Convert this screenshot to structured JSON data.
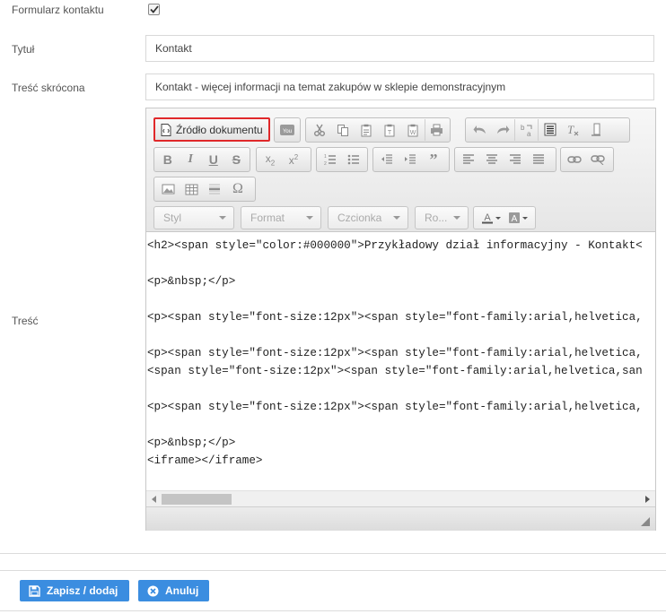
{
  "fields": {
    "contact_form_label": "Formularz kontaktu",
    "contact_form_checked": true,
    "title_label": "Tytuł",
    "title_value": "Kontakt",
    "summary_label": "Treść skrócona",
    "summary_value": "Kontakt - więcej informacji na temat zakupów w sklepie demonstracyjnym",
    "content_label": "Treść"
  },
  "editor": {
    "source_button_label": "Źródło dokumentu",
    "combos": {
      "style": "Styl",
      "format": "Format",
      "font": "Czcionka",
      "size": "Ro..."
    },
    "code_lines": [
      "<h2><span style=\"color:#000000\">Przykładowy dział informacyjny - Kontakt<",
      "<p>&nbsp;</p>",
      "<p><span style=\"font-size:12px\"><span style=\"font-family:arial,helvetica,",
      "<p><span style=\"font-size:12px\"><span style=\"font-family:arial,helvetica,",
      "<span style=\"font-size:12px\"><span style=\"font-family:arial,helvetica,san",
      "<p><span style=\"font-size:12px\"><span style=\"font-family:arial,helvetica,",
      "<p>&nbsp;</p>",
      "<iframe></iframe>"
    ]
  },
  "actions": {
    "save_label": "Zapisz / dodaj",
    "cancel_label": "Anuluj"
  },
  "colors": {
    "accent": "#3b8de0",
    "highlight": "#e0282a"
  }
}
